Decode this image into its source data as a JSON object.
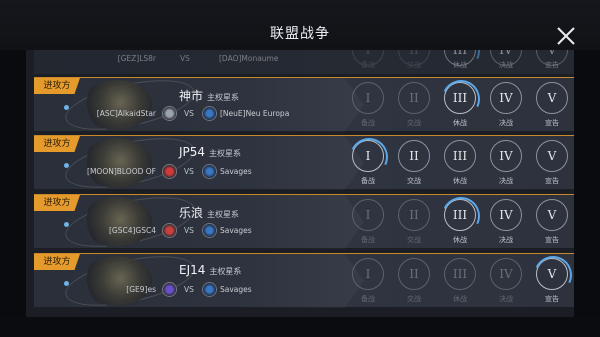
{
  "window": {
    "title": "联盟战争"
  },
  "attack_label": "进攻方",
  "vs_label": "VS",
  "stage_numerals": [
    "I",
    "II",
    "III",
    "IV",
    "V"
  ],
  "stage_labels": [
    "备战",
    "交战",
    "休战",
    "决战",
    "宣告"
  ],
  "partial_row": {
    "left_alliance": "[GEZ]LS8r",
    "right_alliance": "[DAO]Monaume"
  },
  "rows": [
    {
      "planet": "神市",
      "planet_type": "主权星系",
      "left_alliance": "[ASC]AlkaidStar",
      "right_alliance": "[NeuE]Neu Europa",
      "active_stage": 2
    },
    {
      "planet": "JP54",
      "planet_type": "主权星系",
      "left_alliance": "[MOON]BLOOD OF",
      "right_alliance": "Savages",
      "active_stage": 0
    },
    {
      "planet": "乐浪",
      "planet_type": "主权星系",
      "left_alliance": "[GSC4]GSC4",
      "right_alliance": "Savages",
      "active_stage": 2
    },
    {
      "planet": "EJ14",
      "planet_type": "主权星系",
      "left_alliance": "[GE9]es",
      "right_alliance": "Savages",
      "active_stage": 4
    }
  ],
  "colors": {
    "accent_orange": "#e59a2c",
    "progress_blue": "#5aa8ea",
    "panel": "#2f3440"
  },
  "icons": {
    "close": "close-icon",
    "left_flag": "alliance-emblem-icon",
    "right_flag": "alliance-emblem-icon"
  }
}
